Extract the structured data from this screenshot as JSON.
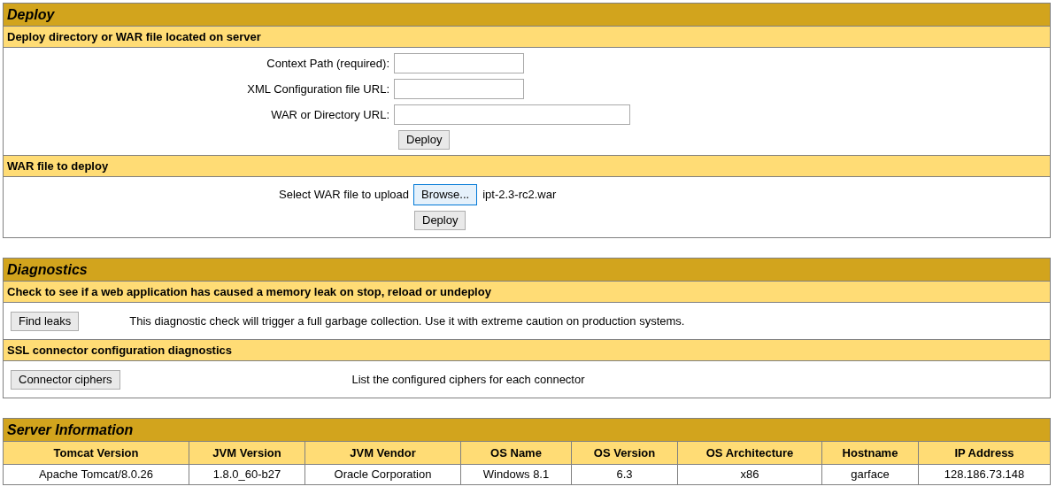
{
  "deploy": {
    "title": "Deploy",
    "server_deploy": {
      "heading": "Deploy directory or WAR file located on server",
      "fields": [
        {
          "label": "Context Path (required):",
          "kind": "short"
        },
        {
          "label": "XML Configuration file URL:",
          "kind": "short"
        },
        {
          "label": "WAR or Directory URL:",
          "kind": "long"
        }
      ],
      "button": "Deploy"
    },
    "war_upload": {
      "heading": "WAR file to deploy",
      "label": "Select WAR file to upload",
      "browse_button": "Browse...",
      "file_name": "ipt-2.3-rc2.war",
      "button": "Deploy"
    }
  },
  "diagnostics": {
    "title": "Diagnostics",
    "checks": [
      {
        "heading": "Check to see if a web application has caused a memory leak on stop, reload or undeploy",
        "button": "Find leaks",
        "description": "This diagnostic check will trigger a full garbage collection. Use it with extreme caution on production systems.",
        "kind": "left"
      },
      {
        "heading": "SSL connector configuration diagnostics",
        "button": "Connector ciphers",
        "description": "List the configured ciphers for each connector",
        "kind": "center"
      }
    ]
  },
  "server_info": {
    "title": "Server Information",
    "columns": [
      "Tomcat Version",
      "JVM Version",
      "JVM Vendor",
      "OS Name",
      "OS Version",
      "OS Architecture",
      "Hostname",
      "IP Address"
    ],
    "rows": [
      [
        "Apache Tomcat/8.0.26",
        "1.8.0_60-b27",
        "Oracle Corporation",
        "Windows 8.1",
        "6.3",
        "x86",
        "garface",
        "128.186.73.148"
      ]
    ]
  }
}
